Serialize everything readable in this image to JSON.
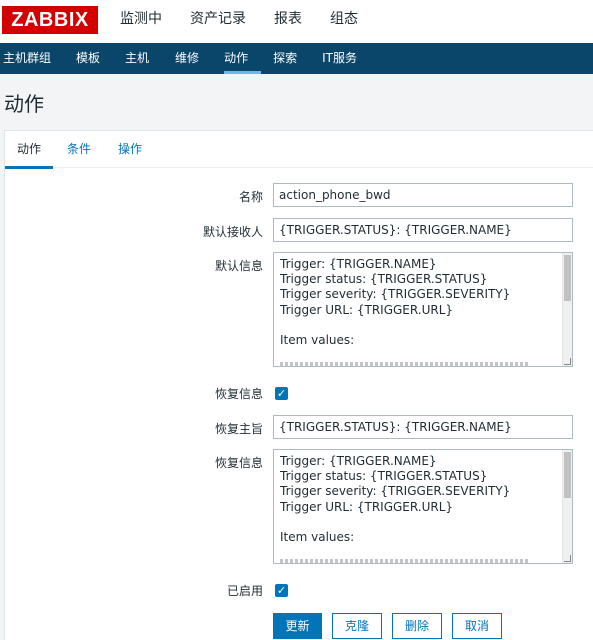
{
  "brand": {
    "logo_text": "ZABBIX",
    "color": "#d40000"
  },
  "main_menu": [
    {
      "label": "监测中"
    },
    {
      "label": "资产记录"
    },
    {
      "label": "报表"
    },
    {
      "label": "组态"
    }
  ],
  "sub_menu": [
    {
      "label": "主机群组"
    },
    {
      "label": "模板"
    },
    {
      "label": "主机"
    },
    {
      "label": "维修"
    },
    {
      "label": "动作"
    },
    {
      "label": "探索"
    },
    {
      "label": "IT服务"
    }
  ],
  "page_title": "动作",
  "tabs": [
    {
      "label": "动作"
    },
    {
      "label": "条件"
    },
    {
      "label": "操作"
    }
  ],
  "form": {
    "name_label": "名称",
    "name_value": "action_phone_bwd",
    "default_recipient_label": "默认接收人",
    "default_recipient_value": "{TRIGGER.STATUS}: {TRIGGER.NAME}",
    "default_message_label": "默认信息",
    "default_message_value": "Trigger: {TRIGGER.NAME}\nTrigger status: {TRIGGER.STATUS}\nTrigger severity: {TRIGGER.SEVERITY}\nTrigger URL: {TRIGGER.URL}\n\nItem values:",
    "recovery_message_label": "恢复信息",
    "recovery_message_checked": true,
    "recovery_subject_label": "恢复主旨",
    "recovery_subject_value": "{TRIGGER.STATUS}: {TRIGGER.NAME}",
    "recovery_text_label": "恢复信息",
    "recovery_text_value": "Trigger: {TRIGGER.NAME}\nTrigger status: {TRIGGER.STATUS}\nTrigger severity: {TRIGGER.SEVERITY}\nTrigger URL: {TRIGGER.URL}\n\nItem values:",
    "enabled_label": "已启用",
    "enabled_checked": true
  },
  "buttons": {
    "update": "更新",
    "clone": "克隆",
    "delete": "删除",
    "cancel": "取消"
  },
  "colors": {
    "nav_bg": "#0a466a",
    "accent": "#0275b8"
  }
}
